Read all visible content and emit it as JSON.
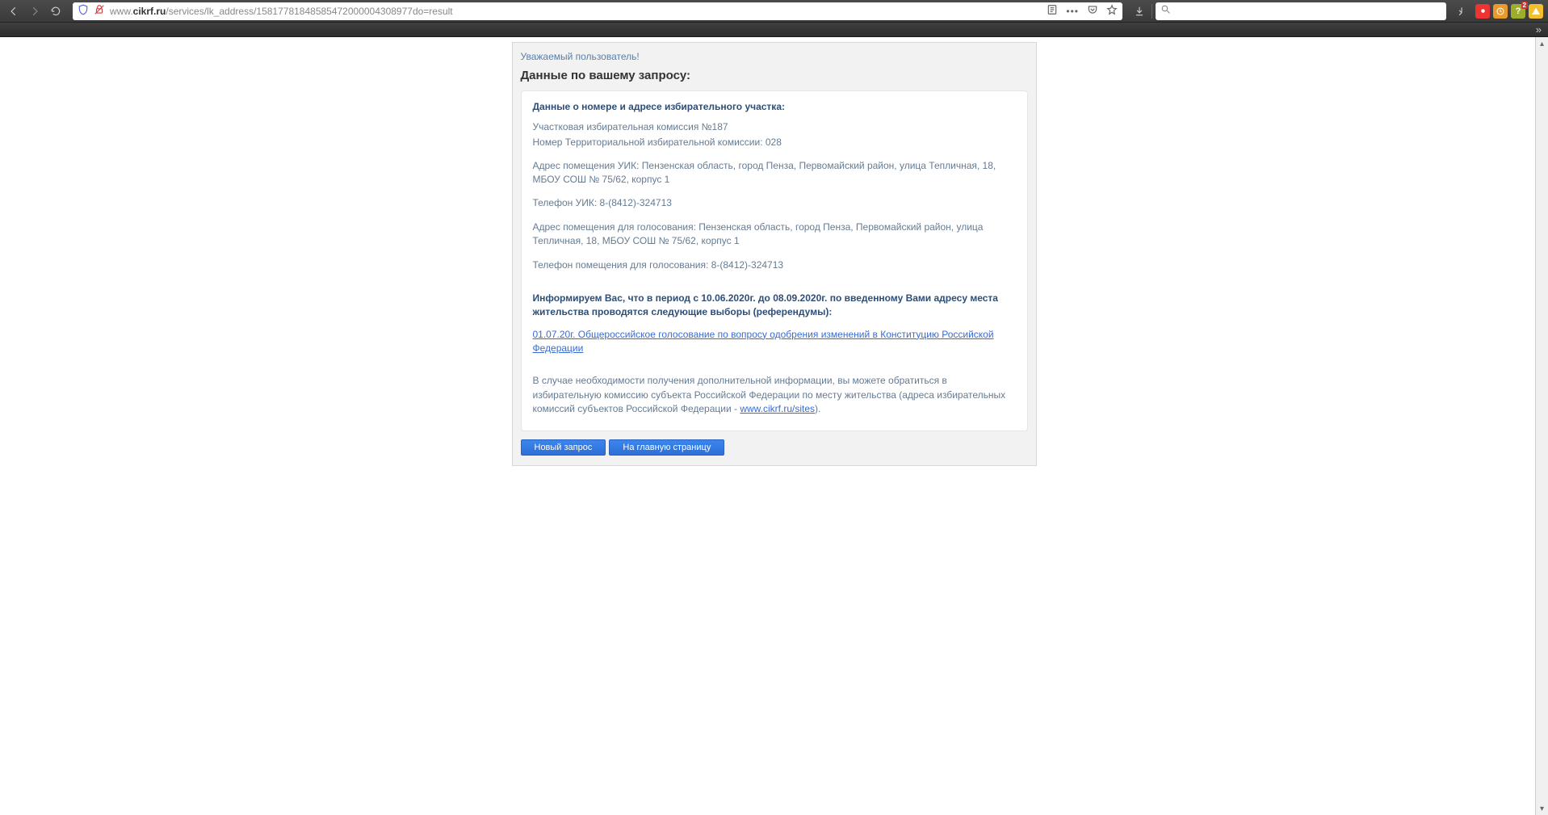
{
  "browser": {
    "url_prefix": "www.",
    "url_domain": "cikrf.ru",
    "url_path": "/services/lk_address/15817781848585472000004308977do=result",
    "search_placeholder": ""
  },
  "page": {
    "greeting": "Уважаемый пользователь!",
    "result_header": "Данные по вашему запросу:",
    "section_title": "Данные о номере и адресе избирательного участка:",
    "commission_name": "Участковая избирательная комиссия №187",
    "territorial_number": "Номер Территориальной избирательной комиссии: 028",
    "uik_address": "Адрес помещения УИК: Пензенская область, город Пенза, Первомайский район, улица Тепличная, 18, МБОУ СОШ № 75/62, корпус 1",
    "uik_phone": "Телефон УИК: 8-(8412)-324713",
    "voting_address": "Адрес помещения для голосования: Пензенская область, город Пенза, Первомайский район, улица Тепличная, 18, МБОУ СОШ № 75/62, корпус 1",
    "voting_phone": "Телефон помещения для голосования: 8-(8412)-324713",
    "notice": "Информируем Вас, что в период с 10.06.2020г. до 08.09.2020г. по введенному Вами адресу места жительства проводятся следующие выборы (референдумы):",
    "event_link": "01.07.20г. Общероссийское голосование по вопросу одобрения изменений в Конституцию Российской Федерации",
    "footnote_pre": "В случае необходимости получения дополнительной информации, вы можете обратиться в избирательную комиссию субъекта Российской Федерации по месту жительства (адреса избирательных комиссий субъектов Российской Федерации - ",
    "footnote_link": "www.cikrf.ru/sites",
    "footnote_post": ").",
    "btn_new_query": "Новый запрос",
    "btn_home": "На главную страницу"
  },
  "ext_badge": "2"
}
